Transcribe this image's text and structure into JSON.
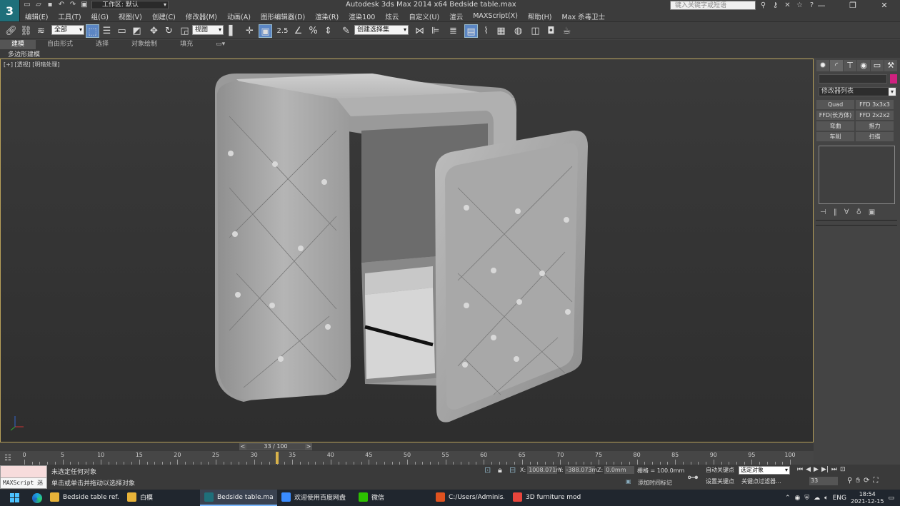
{
  "titlebar": {
    "workspace": "工作区: 默认",
    "title": "Autodesk 3ds Max  2014 x64      Bedside table.max",
    "search_placeholder": "键入关键字或短语",
    "win_min": "—",
    "win_max": "❐",
    "win_close": "✕"
  },
  "menu": [
    "编辑(E)",
    "工具(T)",
    "组(G)",
    "视图(V)",
    "创建(C)",
    "修改器(M)",
    "动画(A)",
    "图形编辑器(D)",
    "渲染(R)",
    "渲染100",
    "炫云",
    "自定义(U)",
    "渲云",
    "MAXScript(X)",
    "帮助(H)",
    "Max 杀毒卫士"
  ],
  "toolbar": {
    "filter": "全部",
    "refcoord": "视图",
    "selection_set": "创建选择集"
  },
  "ribbon": {
    "tabs": [
      "建模",
      "自由形式",
      "选择",
      "对象绘制",
      "填充"
    ],
    "active_tab": "建模",
    "sub": "多边形建模"
  },
  "viewport": {
    "label": "[+] [透视] [明暗处理]"
  },
  "command_panel": {
    "modifier_list": "修改器列表",
    "modifiers": [
      "Quad Chamfer",
      "FFD 3x3x3",
      "FFD(长方体)",
      "FFD 2x2x2",
      "弯曲",
      "推力",
      "车削",
      "扫描"
    ],
    "swatch_color": "#d0217f"
  },
  "time": {
    "slider": "33 / 100",
    "current": 33,
    "total": 100,
    "ticks": [
      0,
      5,
      10,
      15,
      20,
      25,
      30,
      35,
      40,
      45,
      50,
      55,
      60,
      65,
      70,
      75,
      80,
      85,
      90,
      95,
      100
    ]
  },
  "status": {
    "maxscript": "MAXScript 迷",
    "line1": "未选定任何对象",
    "line2": "单击或单击并拖动以选择对象",
    "x_label": "X:",
    "x": "1008.071m",
    "y_label": "Y:",
    "y": "-388.073m",
    "z_label": "Z:",
    "z": "0.0mm",
    "grid": "栅格 = 100.0mm",
    "add_tag": "添加时间标记",
    "autokey": "自动关键点",
    "setkey": "设置关键点",
    "selected": "选定对象",
    "key_filter": "关键点过滤器...",
    "frame": "33"
  },
  "taskbar": {
    "items": [
      {
        "label": "Bedside table ref...",
        "color": "#e8b339"
      },
      {
        "label": "白模",
        "color": "#e8b339"
      },
      {
        "label": "Bedside table.ma...",
        "color": "#1f6f7a"
      },
      {
        "label": "欢迎使用百度网盘",
        "color": "#3a8cff"
      },
      {
        "label": "微信",
        "color": "#2dc100"
      },
      {
        "label": "C:/Users/Adminis...",
        "color": "#e0521f"
      },
      {
        "label": "3D furniture mod...",
        "color": "#e8453c"
      }
    ],
    "active_index": 2,
    "lang": "ENG",
    "time": "18:54",
    "date": "2021-12-15"
  }
}
